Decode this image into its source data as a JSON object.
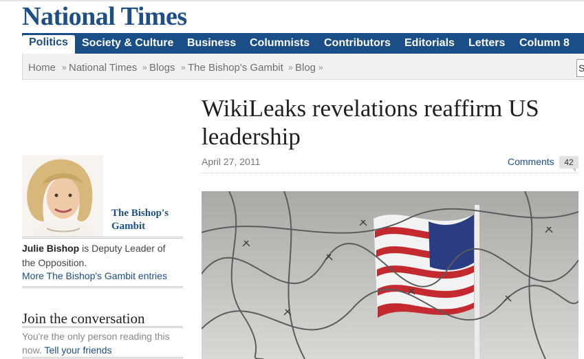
{
  "site": {
    "masthead": "National Times"
  },
  "nav": {
    "items": [
      "Politics",
      "Society & Culture",
      "Business",
      "Columnists",
      "Contributors",
      "Editorials",
      "Letters",
      "Column 8"
    ],
    "active": "Politics"
  },
  "breadcrumb": [
    "Home",
    "National Times",
    "Blogs",
    "The Bishop's Gambit",
    "Blog"
  ],
  "search": {
    "value": "S"
  },
  "sidebar": {
    "blog_name": "The Bishop's Gambit",
    "author_name": "Julie Bishop",
    "author_bio": " is Deputy Leader of the Opposition.",
    "more_link": "More The Bishop's Gambit entries",
    "join_title": "Join the conversation",
    "join_text": "You're the only person reading this now. ",
    "tell_friends": "Tell your friends"
  },
  "article": {
    "headline": "WikiLeaks revelations reaffirm US leadership",
    "date": "April 27, 2011",
    "comments_label": "Comments",
    "comments_count": "42"
  },
  "colors": {
    "brand": "#1a4e86",
    "crumb_bg": "#f1f1f1"
  }
}
